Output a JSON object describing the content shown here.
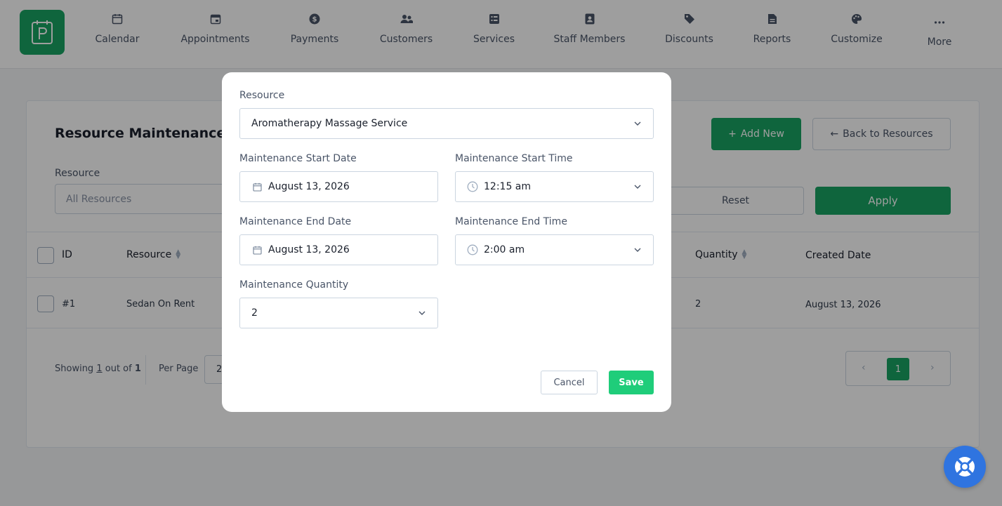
{
  "nav": {
    "items": [
      {
        "label": "Calendar",
        "icon": "calendar-icon"
      },
      {
        "label": "Appointments",
        "icon": "calendar-check-icon"
      },
      {
        "label": "Payments",
        "icon": "dollar-icon"
      },
      {
        "label": "Customers",
        "icon": "users-icon"
      },
      {
        "label": "Services",
        "icon": "list-icon"
      },
      {
        "label": "Staff Members",
        "icon": "id-badge-icon"
      },
      {
        "label": "Discounts",
        "icon": "tag-icon"
      },
      {
        "label": "Reports",
        "icon": "file-icon"
      },
      {
        "label": "Customize",
        "icon": "palette-icon"
      },
      {
        "label": "More",
        "icon": "ellipsis-icon"
      }
    ]
  },
  "page": {
    "title": "Resource Maintenance",
    "add_new_label": "Add New",
    "back_label": "Back to Resources",
    "filter_label": "Resource",
    "filter_placeholder": "All Resources",
    "reset_label": "Reset",
    "apply_label": "Apply"
  },
  "table": {
    "headers": {
      "id": "ID",
      "resource": "Resource",
      "quantity": "Quantity",
      "created": "Created Date"
    },
    "rows": [
      {
        "id": "#1",
        "resource": "Sedan On Rent",
        "quantity": "2",
        "created": "August 13, 2026"
      }
    ]
  },
  "footer": {
    "showing_prefix": "Showing",
    "showing_count": "1",
    "showing_mid": "out of",
    "showing_total": "1",
    "per_page_label": "Per Page",
    "per_page_value": "2",
    "current_page": "1"
  },
  "modal": {
    "resource_label": "Resource",
    "resource_value": "Aromatherapy Massage Service",
    "start_date_label": "Maintenance Start Date",
    "start_date_value": "August 13, 2026",
    "start_time_label": "Maintenance Start Time",
    "start_time_value": "12:15 am",
    "end_date_label": "Maintenance End Date",
    "end_date_value": "August 13, 2026",
    "end_time_label": "Maintenance End Time",
    "end_time_value": "2:00 am",
    "quantity_label": "Maintenance Quantity",
    "quantity_value": "2",
    "cancel_label": "Cancel",
    "save_label": "Save"
  },
  "colors": {
    "brand_green": "#19a463",
    "save_green": "#1fcd7a",
    "help_blue": "#2f74e0"
  }
}
